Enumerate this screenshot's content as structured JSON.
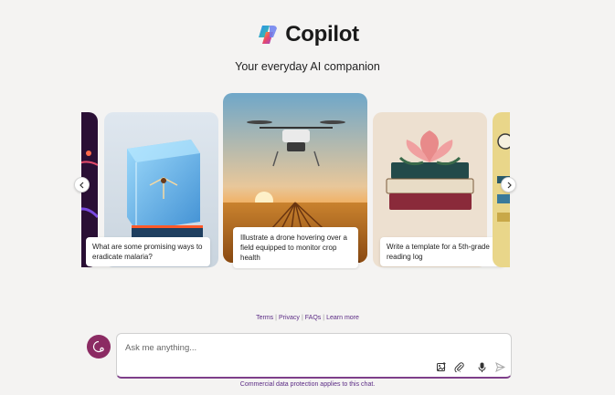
{
  "header": {
    "brand": "Copilot",
    "tagline": "Your everyday AI companion"
  },
  "carousel": {
    "cards": [
      {
        "caption": ""
      },
      {
        "caption": "What are some promising ways to eradicate malaria?"
      },
      {
        "caption": "Illustrate a drone hovering over a field equipped to monitor crop health"
      },
      {
        "caption": "Write a template for a 5th-grade reading log"
      },
      {
        "caption": ""
      }
    ],
    "prev_icon": "chevron-left-icon",
    "next_icon": "chevron-right-icon"
  },
  "footer_links": [
    "Terms",
    "Privacy",
    "FAQs",
    "Learn more"
  ],
  "chat": {
    "placeholder": "Ask me anything...",
    "tools": [
      "image-insert-icon",
      "paperclip-icon",
      "microphone-icon",
      "send-icon"
    ]
  },
  "disclaimer": {
    "link": "Commercial data protection",
    "text": " applies to this chat."
  },
  "colors": {
    "accent": "#8b2b63",
    "link": "#5b2b85",
    "background": "#f4f3f2"
  }
}
